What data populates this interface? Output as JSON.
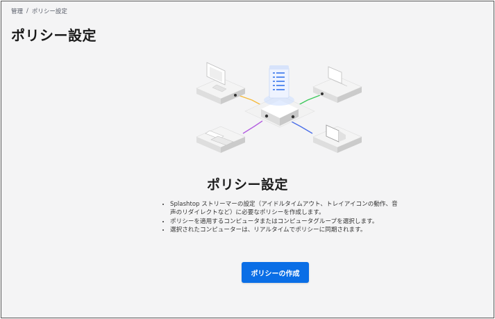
{
  "breadcrumb": {
    "parent": "管理",
    "separator": "/",
    "current": "ポリシー設定"
  },
  "page": {
    "title": "ポリシー設定"
  },
  "empty_state": {
    "title": "ポリシー設定",
    "bullets": [
      "Splashtop ストリーマーの設定（アイドルタイムアウト、トレイアイコンの動作、音声のリダイレクトなど）に必要なポリシーを作成します。",
      "ポリシーを適用するコンピュータまたはコンピュータグループを選択します。",
      "選択されたコンピューターは、リアルタイムでポリシーに同期されます。"
    ],
    "button_label": "ポリシーの作成"
  },
  "colors": {
    "accent": "#0a6ee6",
    "background": "#f4f4f5",
    "line_orange": "#f5b93a",
    "line_green": "#3cc85a",
    "line_purple": "#b35ee0",
    "line_blue": "#4a6ee8",
    "document_blue": "#5b8ef0"
  }
}
